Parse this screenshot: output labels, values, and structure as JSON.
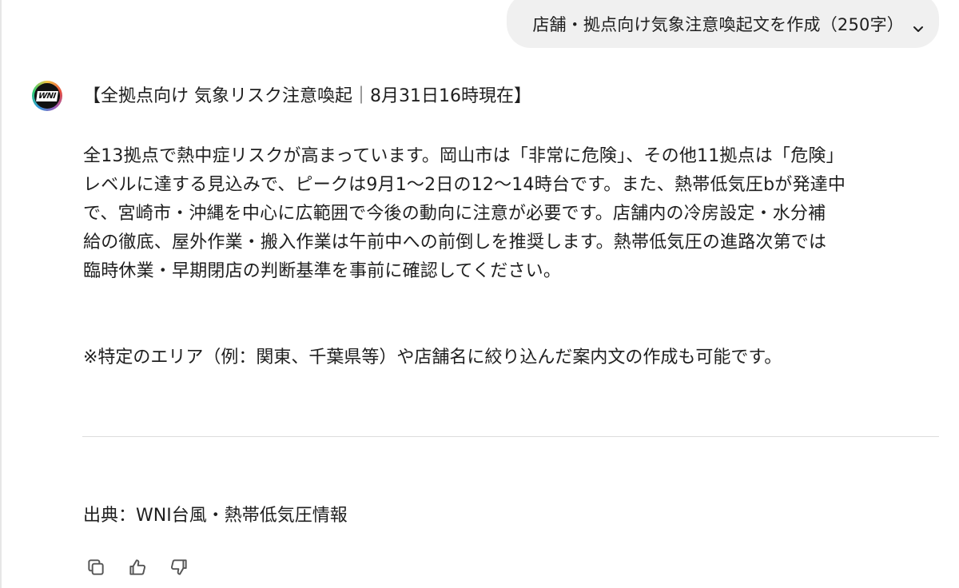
{
  "prompt": {
    "text": "店舗・拠点向け気象注意喚起文を作成（250字）",
    "expand_icon": "chevron-down-icon"
  },
  "assistant": {
    "avatar_text": "WNI",
    "heading": "【全拠点向け 気象リスク注意喚起｜8月31日16時現在】",
    "body_lines": [
      "全13拠点で熱中症リスクが高まっています。岡山市は「非常に危険」、その他11拠点は「危険」",
      "レベルに達する見込みで、ピークは9月1〜2日の12〜14時台です。また、熱帯低気圧bが発達中",
      "で、宮崎市・沖縄を中心に広範囲で今後の動向に注意が必要です。店舗内の冷房設定・水分補",
      "給の徹底、屋外作業・搬入作業は午前中への前倒しを推奨します。熱帯低気圧の進路次第では",
      "臨時休業・早期閉店の判断基準を事前に確認してください。"
    ],
    "note": "※特定のエリア（例：関東、千葉県等）や店舗名に絞り込んだ案内文の作成も可能です。",
    "source": "出典：WNI台風・熱帯低気圧情報"
  },
  "actions": {
    "copy_icon": "copy-icon",
    "thumbs_up_icon": "thumbs-up-icon",
    "thumbs_down_icon": "thumbs-down-icon"
  },
  "colors": {
    "text": "#1f1f1f",
    "chip_bg": "#f0f0f0",
    "divider": "#dcdcdc",
    "icon": "#555555"
  }
}
